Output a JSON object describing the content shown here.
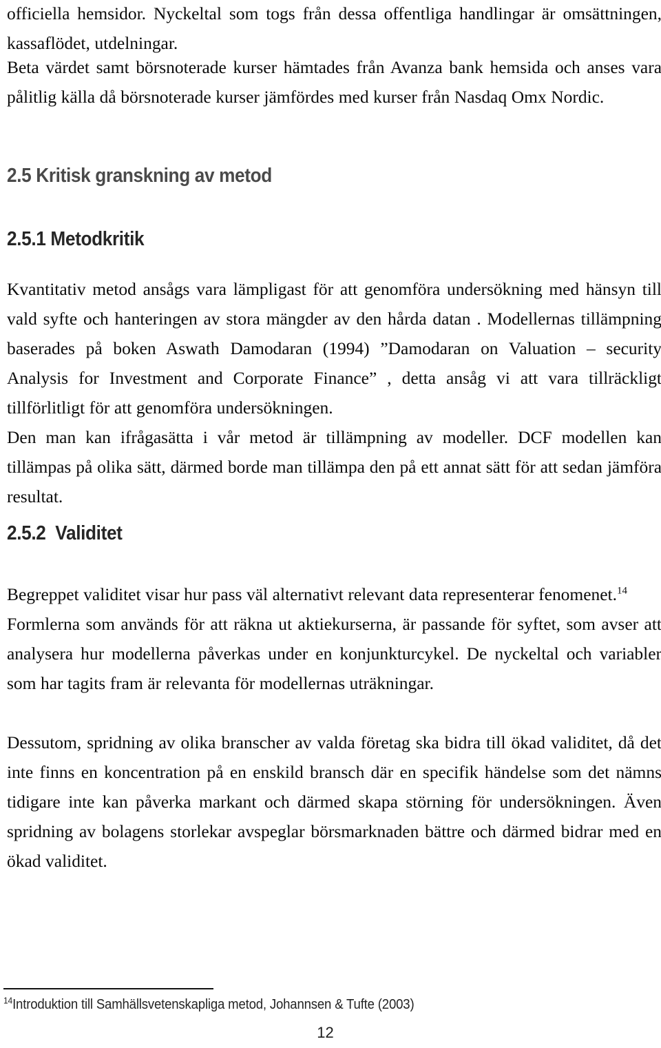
{
  "document": {
    "language": "sv",
    "page_number": "12",
    "text_color": "#0b0b0b",
    "heading_major_color": "#4a4a4a",
    "heading_minor_color": "#262626"
  },
  "paragraphs": {
    "intro": "officiella hemsidor. Nyckeltal som togs från dessa offentliga handlingar är omsättningen, kassaflödet, utdelningar.",
    "beta": "Beta värdet samt börsnoterade kurser hämtades från Avanza bank hemsida och anses vara pålitlig källa då börsnoterade kurser jämfördes med kurser från Nasdaq Omx Nordic.",
    "metod": "Kvantitativ metod ansågs vara lämpligast för att genomföra undersökning med hänsyn till vald syfte och hanteringen av stora mängder av den hårda datan . Modellernas tillämpning baserades på boken Aswath Damodaran (1994) ”Damodaran on Valuation – security Analysis for Investment and Corporate Finance” , detta ansåg vi att vara tillräckligt tillförlitligt för att genomföra undersökningen.",
    "dcf": "Den man kan ifrågasätta i vår metod är tillämpning av modeller. DCF modellen kan tillämpas på olika sätt, därmed borde man tillämpa den på ett annat sätt för att sedan jämföra resultat.",
    "validitet_lead": "Begreppet validitet visar hur pass väl alternativt relevant data representerar fenomenet.",
    "validitet_lead_footnote_marker": "14",
    "formler": "Formlerna som används för att räkna ut aktiekurserna, är passande för syftet, som avser att analysera hur modellerna påverkas under en konjunkturcykel. De nyckeltal och variabler som har tagits fram är relevanta för modellernas uträkningar.",
    "dessutom": "Dessutom, spridning av olika branscher av valda företag ska bidra till ökad validitet, då det inte finns en koncentration på en enskild bransch där en specifik händelse som det nämns tidigare inte kan påverka markant och därmed skapa störning för undersökningen. Även spridning av bolagens storlekar avspeglar börsmarknaden bättre och därmed bidrar med en ökad validitet."
  },
  "headings": {
    "section_25": "2.5 Kritisk granskning av metod",
    "section_251": "2.5.1 Metodkritik",
    "section_252": "2.5.2  Validitet"
  },
  "footnote": {
    "marker": "14",
    "text": "Introduktion till Samhällsvetenskapliga metod, Johannsen & Tufte  (2003)"
  }
}
